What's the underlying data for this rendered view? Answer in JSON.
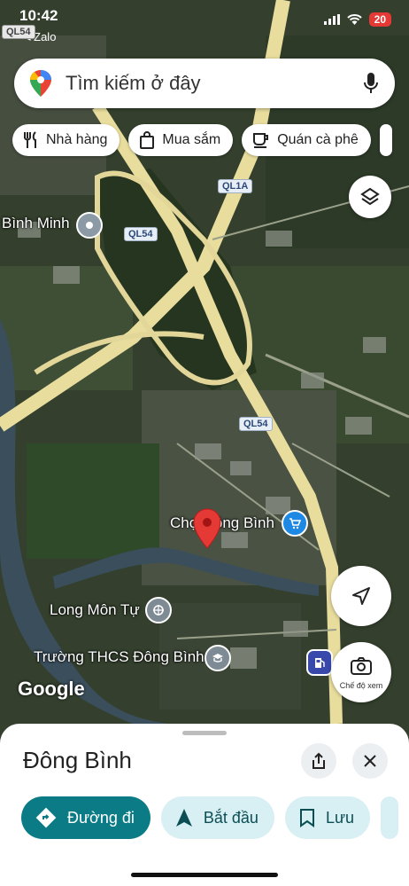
{
  "status_bar": {
    "time": "10:42",
    "back_app": "Zalo",
    "battery": "20"
  },
  "search": {
    "placeholder": "Tìm kiếm ở đây"
  },
  "chips": [
    {
      "label": "Nhà hàng",
      "icon": "fork-knife-icon"
    },
    {
      "label": "Mua sắm",
      "icon": "shopping-bag-icon"
    },
    {
      "label": "Quán cà phê",
      "icon": "coffee-cup-icon"
    }
  ],
  "map": {
    "road_shields": {
      "ql54_top": "QL54",
      "ql1a": "QL1A",
      "ql54_mid": "QL54",
      "ql54_low": "QL54"
    },
    "labels": {
      "binh_minh": "Bình Minh",
      "cho_dong_binh": "Chợ Đông Bình",
      "long_mon_tu": "Long Môn Tự",
      "truong_thcs": "Trường THCS Đông Bình"
    },
    "attribution": "Google",
    "view_mode_label": "Chế độ xem"
  },
  "sheet": {
    "title": "Đông Bình",
    "actions": {
      "directions": "Đường đi",
      "start": "Bắt đầu",
      "save": "Lưu"
    }
  },
  "colors": {
    "pin": "#e53935",
    "primary": "#0b7c86",
    "secondary": "#d8eff3",
    "road": "#e9dd9e",
    "water": "#3a4e5c"
  }
}
